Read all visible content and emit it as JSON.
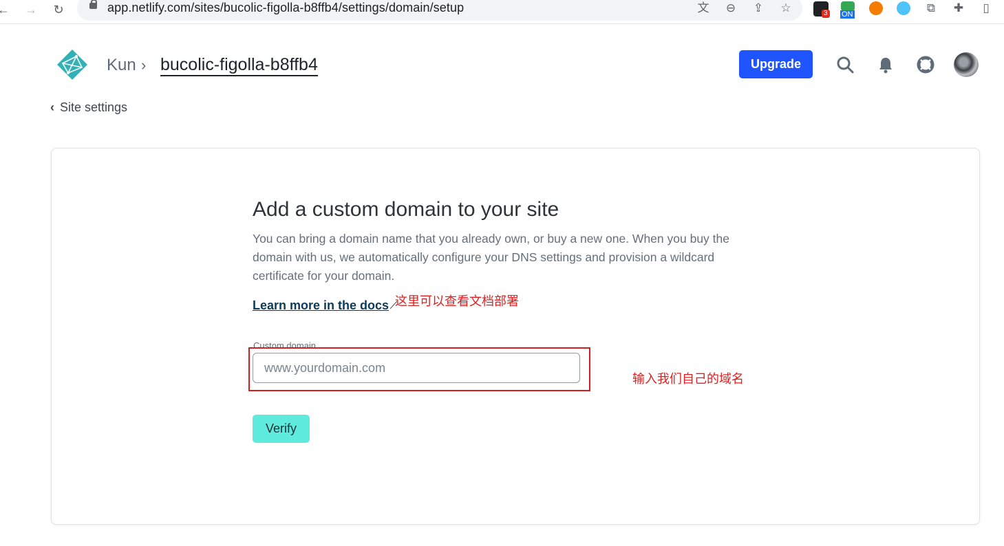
{
  "browser": {
    "url": "app.netlify.com/sites/bucolic-figolla-b8ffb4/settings/domain/setup",
    "ext_badge": "3",
    "ext_on_label": "ON"
  },
  "header": {
    "team": "Kun",
    "site": "bucolic-figolla-b8ffb4",
    "upgrade_label": "Upgrade"
  },
  "nav": {
    "back_label": "Site settings"
  },
  "main": {
    "title": "Add a custom domain to your site",
    "description": "You can bring a domain name that you already own, or buy a new one. When you buy the domain with us, we automatically configure your DNS settings and provision a wildcard certificate for your domain.",
    "docs_link": "Learn more in the docs",
    "field_label": "Custom domain",
    "input_placeholder": "www.yourdomain.com",
    "input_value": "",
    "verify_label": "Verify"
  },
  "annotations": {
    "docs_note": "这里可以查看文档部署",
    "input_note": "输入我们自己的域名"
  },
  "colors": {
    "upgrade": "#1f54ff",
    "verify": "#5eeadd",
    "annotation": "#e02020"
  }
}
